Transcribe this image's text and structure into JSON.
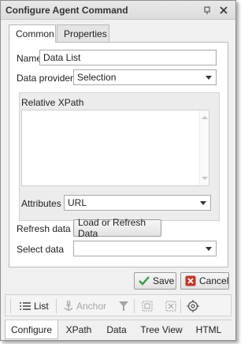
{
  "window": {
    "title": "Configure Agent Command"
  },
  "tabs": [
    {
      "label": "Common"
    },
    {
      "label": "Properties"
    }
  ],
  "form": {
    "name_label": "Name",
    "name_value": "Data List",
    "data_provider_label": "Data provider",
    "data_provider_value": "Selection",
    "relative_xpath_label": "Relative XPath",
    "relative_xpath_value": "",
    "attributes_label": "Attributes",
    "attributes_value": "URL",
    "refresh_label": "Refresh data",
    "refresh_button": "Load or Refresh Data",
    "select_data_label": "Select data",
    "select_data_value": ""
  },
  "actions": {
    "save": "Save",
    "cancel": "Cancel"
  },
  "toolbar": {
    "list": "List",
    "anchor": "Anchor"
  },
  "bottom_tabs": [
    {
      "label": "Configure"
    },
    {
      "label": "XPath"
    },
    {
      "label": "Data"
    },
    {
      "label": "Tree View"
    },
    {
      "label": "HTML"
    }
  ],
  "colors": {
    "save_check": "#3a9a3a",
    "cancel_x": "#c0392b"
  }
}
